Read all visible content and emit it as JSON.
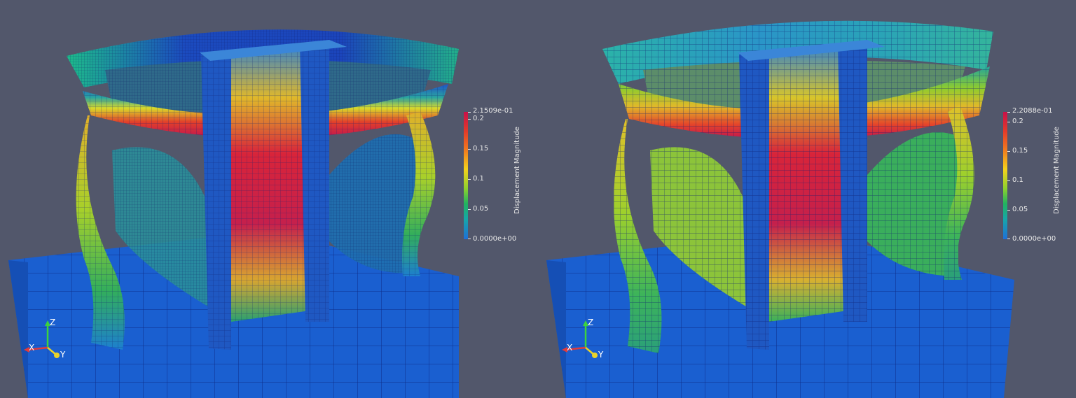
{
  "views": [
    {
      "id": "left",
      "colorbar": {
        "title": "Displacement Magnitude",
        "max_label": "2.1509e-01",
        "min_label": "0.0000e+00",
        "ticks": [
          "0.2",
          "0.15",
          "0.1",
          "0.05"
        ]
      },
      "axes": {
        "x": "X",
        "y": "Y",
        "z": "Z"
      }
    },
    {
      "id": "right",
      "colorbar": {
        "title": "Displacement Magnitude",
        "max_label": "2.2088e-01",
        "min_label": "0.0000e+00",
        "ticks": [
          "0.2",
          "0.15",
          "0.1",
          "0.05"
        ]
      },
      "axes": {
        "x": "X",
        "y": "Y",
        "z": "Z"
      }
    }
  ],
  "colors": {
    "background": "#52576b",
    "base_block": "#1a5fd0",
    "max": "#c8104a",
    "min": "#1f6fd8"
  }
}
